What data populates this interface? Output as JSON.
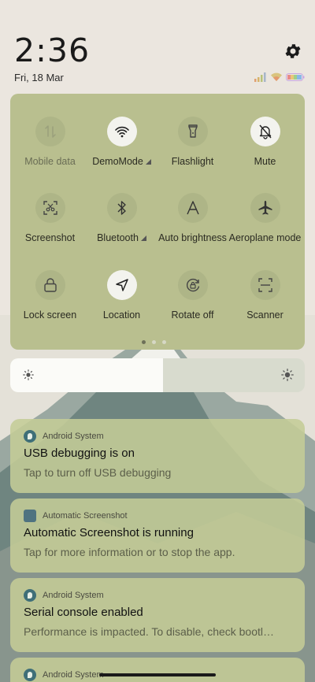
{
  "status": {
    "time": "2:36",
    "date": "Fri, 18 Mar",
    "settings_icon": "gear-icon",
    "indicators": [
      "signal-icon",
      "wifi-icon",
      "battery-icon"
    ]
  },
  "quick_settings": {
    "tiles": [
      {
        "label": "Mobile data",
        "icon": "mobile-data-icon",
        "active": false,
        "disabled": true
      },
      {
        "label": "DemoMode",
        "icon": "wifi-icon",
        "active": true,
        "has_signal": true
      },
      {
        "label": "Flashlight",
        "icon": "flashlight-icon",
        "active": false
      },
      {
        "label": "Mute",
        "icon": "mute-bell-icon",
        "active": true
      },
      {
        "label": "Screenshot",
        "icon": "screenshot-icon",
        "active": false
      },
      {
        "label": "Bluetooth",
        "icon": "bluetooth-icon",
        "active": false,
        "has_signal": true
      },
      {
        "label": "Auto brightness",
        "icon": "auto-brightness-icon",
        "active": false
      },
      {
        "label": "Aeroplane mode",
        "icon": "airplane-icon",
        "active": false
      },
      {
        "label": "Lock screen",
        "icon": "lock-icon",
        "active": false
      },
      {
        "label": "Location",
        "icon": "location-icon",
        "active": true
      },
      {
        "label": "Rotate off",
        "icon": "rotate-lock-icon",
        "active": false
      },
      {
        "label": "Scanner",
        "icon": "scanner-icon",
        "active": false
      }
    ],
    "pages": 3,
    "current_page": 1
  },
  "brightness": {
    "level": 0.52
  },
  "notifications": [
    {
      "app": "Android System",
      "icon": "android-system-icon",
      "title": "USB debugging is on",
      "body": "Tap to turn off USB debugging"
    },
    {
      "app": "Automatic Screenshot",
      "icon": "automatic-screenshot-icon",
      "title": "Automatic Screenshot is running",
      "body": "Tap for more information or to stop the app."
    },
    {
      "app": "Android System",
      "icon": "android-system-icon",
      "title": "Serial console enabled",
      "body": "Performance is impacted. To disable, check bootl…"
    },
    {
      "app": "Android System",
      "icon": "android-system-icon",
      "title": "",
      "body": ""
    }
  ],
  "colors": {
    "panel": "#b9bf8f",
    "active_tile": "#f3f3ee",
    "notification": "#c4cc96"
  }
}
